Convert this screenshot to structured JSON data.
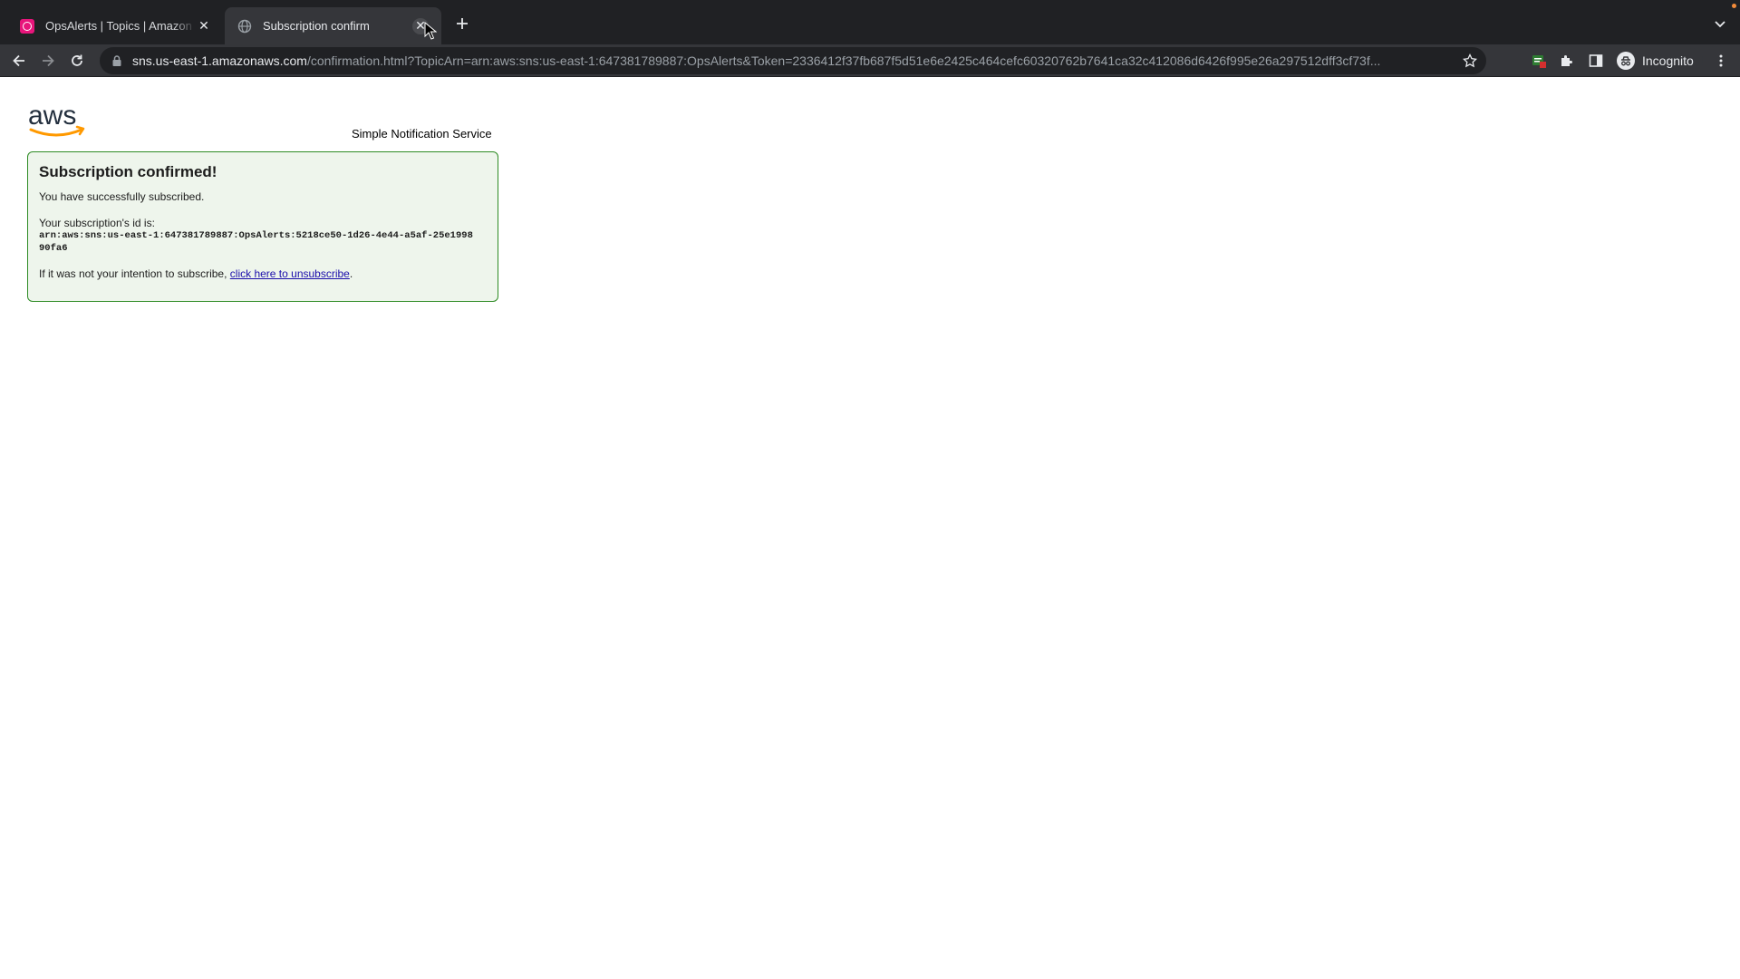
{
  "browser": {
    "tabs": [
      {
        "title": "OpsAlerts | Topics | Amazon SNS",
        "favicon": "sns-icon",
        "active": false
      },
      {
        "title": "Subscription confirm",
        "favicon": "globe-icon",
        "active": true
      }
    ],
    "url_host": "sns.us-east-1.amazonaws.com",
    "url_rest": "/confirmation.html?TopicArn=arn:aws:sns:us-east-1:647381789887:OpsAlerts&Token=2336412f37fb687f5d51e6e2425c464cefc60320762b7641ca32c412086d6426f995e26a297512dff3cf73f...",
    "profile_label": "Incognito"
  },
  "page": {
    "logo_text": "aws",
    "service_name": "Simple Notification Service",
    "confirm_title": "Subscription confirmed!",
    "success_text": "You have successfully subscribed.",
    "id_label": "Your subscription's id is:",
    "subscription_id": "arn:aws:sns:us-east-1:647381789887:OpsAlerts:5218ce50-1d26-4e44-a5af-25e199890fa6",
    "unsub_prefix": "If it was not your intention to subscribe, ",
    "unsub_link": "click here to unsubscribe",
    "unsub_suffix": "."
  },
  "colors": {
    "chrome_dark": "#202124",
    "toolbar": "#35363a",
    "box_border": "#2e8b24",
    "box_bg": "#eef5ec",
    "aws_orange": "#f90",
    "link": "#1a0dab"
  }
}
